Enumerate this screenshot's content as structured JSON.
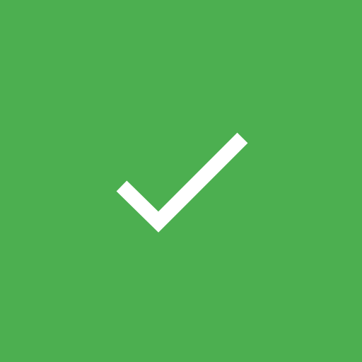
{
  "tile": {
    "background_color": "#4caf50",
    "icon": "check-icon",
    "icon_color": "#ffffff"
  }
}
